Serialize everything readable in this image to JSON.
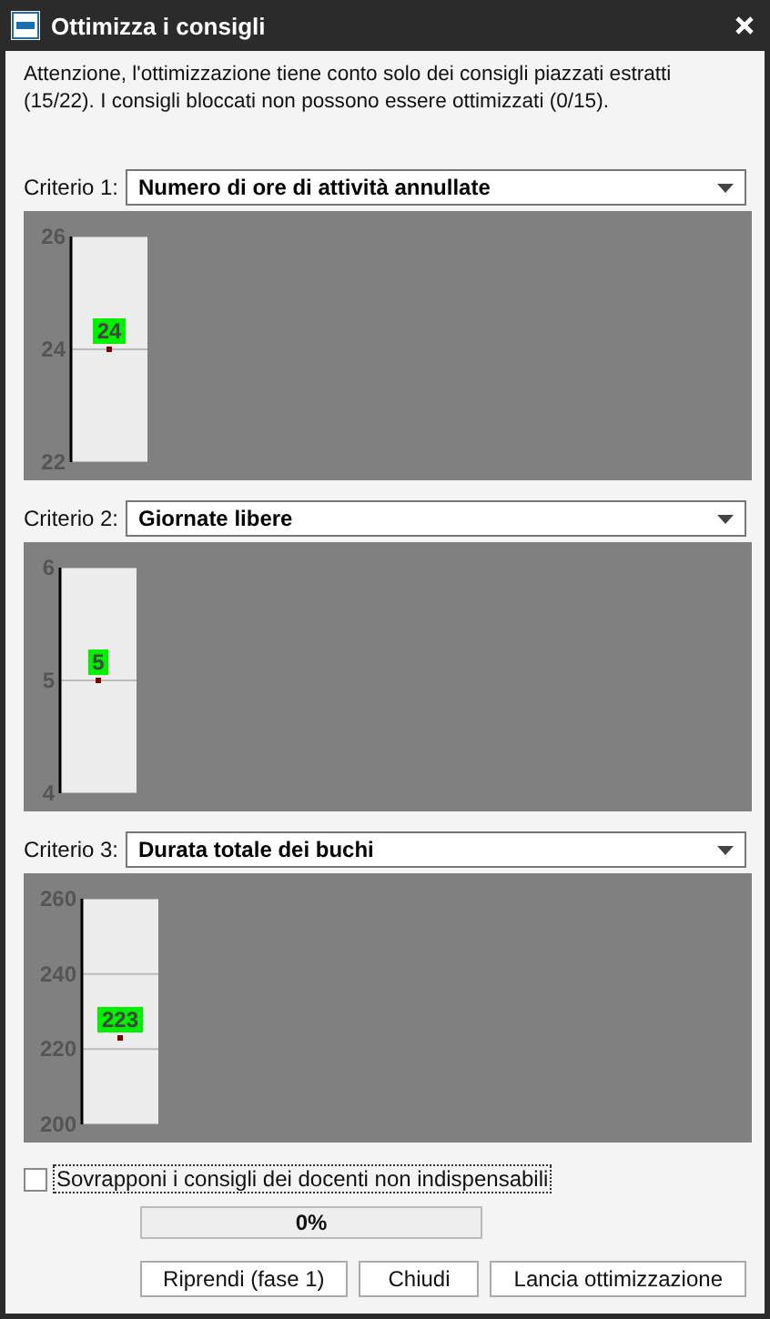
{
  "window": {
    "title": "Ottimizza i consigli"
  },
  "notice": "Attenzione, l'ottimizzazione tiene conto solo dei consigli piazzati estratti (15/22). I consigli bloccati non possono essere ottimizzati (0/15).",
  "criteria": [
    {
      "label": "Criterio 1:",
      "value": "Numero di ore di attività annullate",
      "scale": {
        "ticks": [
          "26",
          "24",
          "22"
        ],
        "marker": {
          "label": "24",
          "level": 0.5
        }
      }
    },
    {
      "label": "Criterio 2:",
      "value": "Giornate libere",
      "scale": {
        "ticks": [
          "6",
          "5",
          "4"
        ],
        "marker": {
          "label": "5",
          "level": 0.5
        }
      }
    },
    {
      "label": "Criterio 3:",
      "value": "Durata totale dei buchi",
      "scale": {
        "ticks": [
          "260",
          "240",
          "220",
          "200"
        ],
        "marker": {
          "label": "223",
          "level": 0.383
        }
      }
    }
  ],
  "overlap_option": {
    "label": "Sovrapponi i consigli dei docenti non indispensabili",
    "checked": false
  },
  "progress": {
    "text": "0%",
    "level": 0
  },
  "buttons": [
    "Riprendi (fase 1)",
    "Chiudi",
    "Lancia ottimizzazione"
  ]
}
